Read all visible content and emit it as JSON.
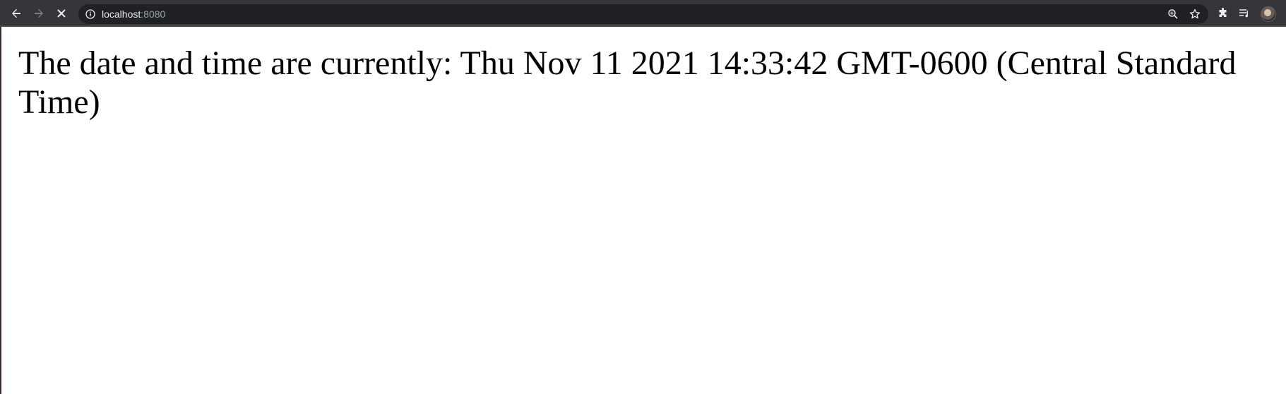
{
  "browser": {
    "url_host": "localhost",
    "url_port": ":8080",
    "icons": {
      "back": "back-arrow-icon",
      "forward": "forward-arrow-icon",
      "stop": "stop-loading-icon",
      "site_info": "info-icon",
      "zoom": "zoom-icon",
      "bookmark": "star-icon",
      "extensions": "puzzle-icon",
      "media": "media-queue-icon",
      "profile": "avatar"
    },
    "colors": {
      "toolbar": "#35363a",
      "omnibox": "#202124",
      "url_text": "#e8eaed",
      "url_port": "#9aa0a6"
    }
  },
  "page": {
    "message": "The date and time are currently: Thu Nov 11 2021 14:33:42 GMT-0600 (Central Standard Time)"
  }
}
